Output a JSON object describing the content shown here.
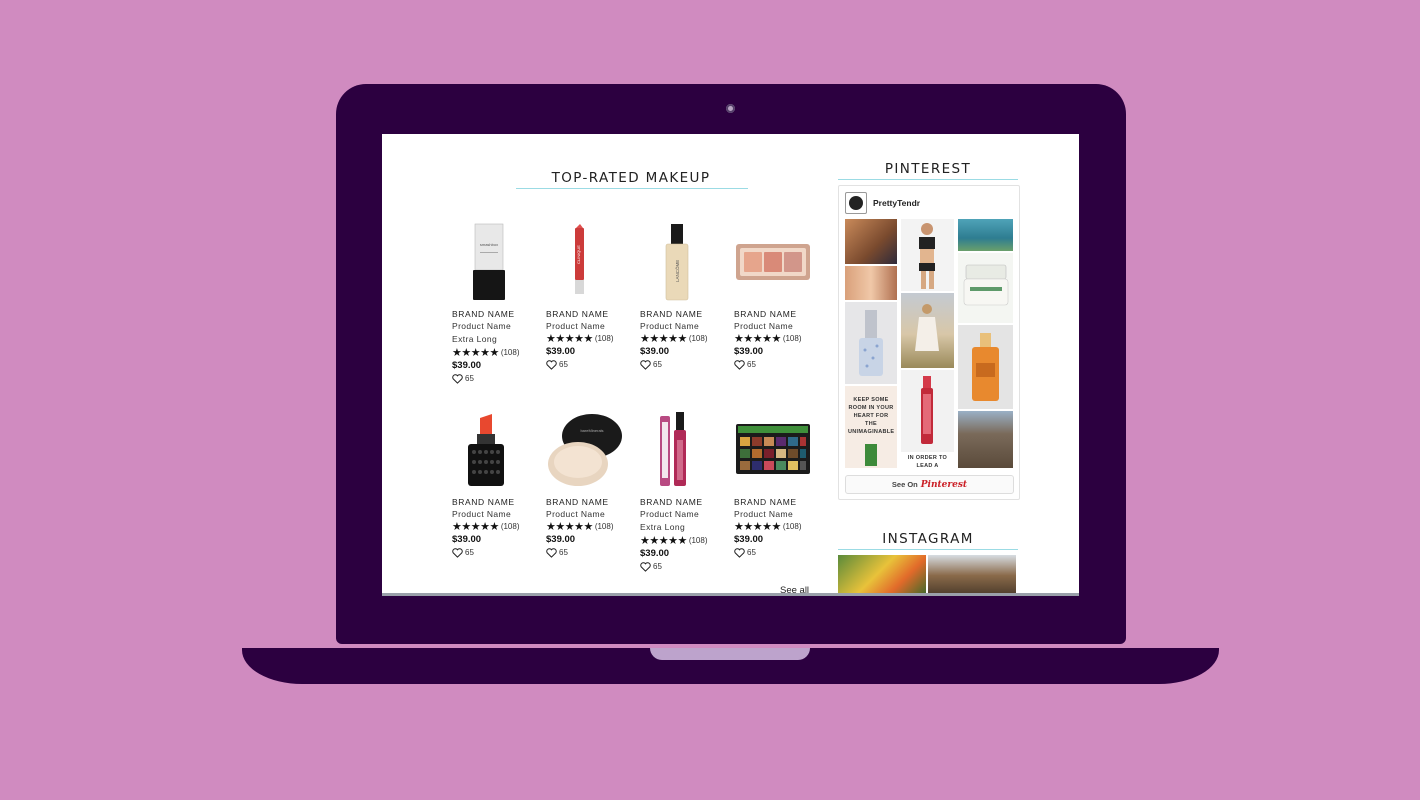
{
  "main": {
    "title": "TOP-RATED MAKEUP",
    "see_all": "See all",
    "products": [
      {
        "brand": "BRAND NAME",
        "name": "Product Name",
        "variant": "Extra Long",
        "stars": "★★★★★",
        "count": "(108)",
        "price": "$39.00",
        "likes": "65",
        "image": "primer-tube-icon"
      },
      {
        "brand": "BRAND NAME",
        "name": "Product Name",
        "variant": "",
        "stars": "★★★★★",
        "count": "(108)",
        "price": "$39.00",
        "likes": "65",
        "image": "lip-crayon-icon"
      },
      {
        "brand": "BRAND NAME",
        "name": "Product Name",
        "variant": "",
        "stars": "★★★★★",
        "count": "(108)",
        "price": "$39.00",
        "likes": "65",
        "image": "foundation-bottle-icon"
      },
      {
        "brand": "BRAND NAME",
        "name": "Product Name",
        "variant": "",
        "stars": "★★★★★",
        "count": "(108)",
        "price": "$39.00",
        "likes": "65",
        "image": "blush-palette-icon"
      },
      {
        "brand": "BRAND NAME",
        "name": "Product Name",
        "variant": "",
        "stars": "★★★★★",
        "count": "(108)",
        "price": "$39.00",
        "likes": "65",
        "image": "lipstick-icon"
      },
      {
        "brand": "BRAND NAME",
        "name": "Product Name",
        "variant": "",
        "stars": "★★★★★",
        "count": "(108)",
        "price": "$39.00",
        "likes": "65",
        "image": "powder-jar-icon"
      },
      {
        "brand": "BRAND NAME",
        "name": "Product Name",
        "variant": "Extra Long",
        "stars": "★★★★★",
        "count": "(108)",
        "price": "$39.00",
        "likes": "65",
        "image": "lip-gloss-icon"
      },
      {
        "brand": "BRAND NAME",
        "name": "Product Name",
        "variant": "",
        "stars": "★★★★★",
        "count": "(108)",
        "price": "$39.00",
        "likes": "65",
        "image": "eyeshadow-palette-icon"
      }
    ]
  },
  "pinterest": {
    "title": "PINTEREST",
    "username": "PrettyTendr",
    "see_on": "See On",
    "logo_text": "Pinterest",
    "tile_quote": "KEEP SOME ROOM IN YOUR HEART FOR THE UNIMAGINABLE",
    "tile_quote2": "IN ORDER TO LEAD A"
  },
  "instagram": {
    "title": "INSTAGRAM"
  },
  "colors": {
    "background": "#d08bc0",
    "laptop": "#2c0040",
    "accent_rule": "#9bdbe4",
    "pinterest_red": "#cb2027"
  }
}
